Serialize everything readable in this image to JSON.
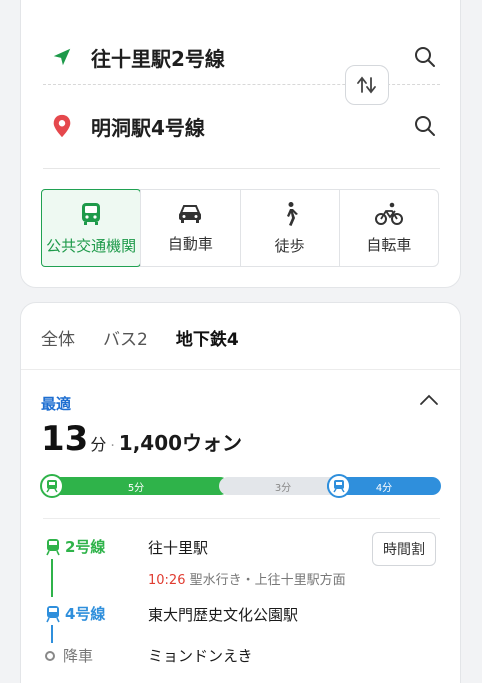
{
  "route": {
    "origin": "往十里駅2号線",
    "destination": "明洞駅4号線",
    "swap_glyph": "↑↓"
  },
  "modes": [
    {
      "label": "公共交通機関",
      "icon": "bus-icon",
      "active": true
    },
    {
      "label": "自動車",
      "icon": "car-icon",
      "active": false
    },
    {
      "label": "徒歩",
      "icon": "walk-icon",
      "active": false
    },
    {
      "label": "自転車",
      "icon": "bike-icon",
      "active": false
    }
  ],
  "tabs": [
    {
      "label": "全体",
      "active": false
    },
    {
      "label": "バス2",
      "active": false
    },
    {
      "label": "地下鉄4",
      "active": true
    }
  ],
  "result": {
    "best_label": "最適",
    "time_value": "13",
    "time_unit": "分",
    "separator": "·",
    "fare": "1,400ウォン",
    "segments": [
      {
        "label": "5分",
        "color": "#2fb34a"
      },
      {
        "label": "3分",
        "color": "#e3e6ea"
      },
      {
        "label": "4分",
        "color": "#2f8fdc"
      }
    ]
  },
  "legs": [
    {
      "line": "2号線",
      "line_color": "#2fb34a",
      "station": "往十里駅",
      "depart_time": "10:26",
      "direction": "聖水行き・上往十里駅方面",
      "timetable_label": "時間割"
    },
    {
      "line": "4号線",
      "line_color": "#2f8fdc",
      "station": "東大門歴史文化公園駅"
    },
    {
      "line": "降車",
      "line_color": "#777777",
      "station": "ミョンドンえき"
    }
  ],
  "colors": {
    "accent_green": "#20a152",
    "line2": "#2fb34a",
    "line4": "#2f8fdc",
    "best_blue": "#1f6fd1",
    "time_red": "#e03c31",
    "pin_red": "#e5484d"
  }
}
